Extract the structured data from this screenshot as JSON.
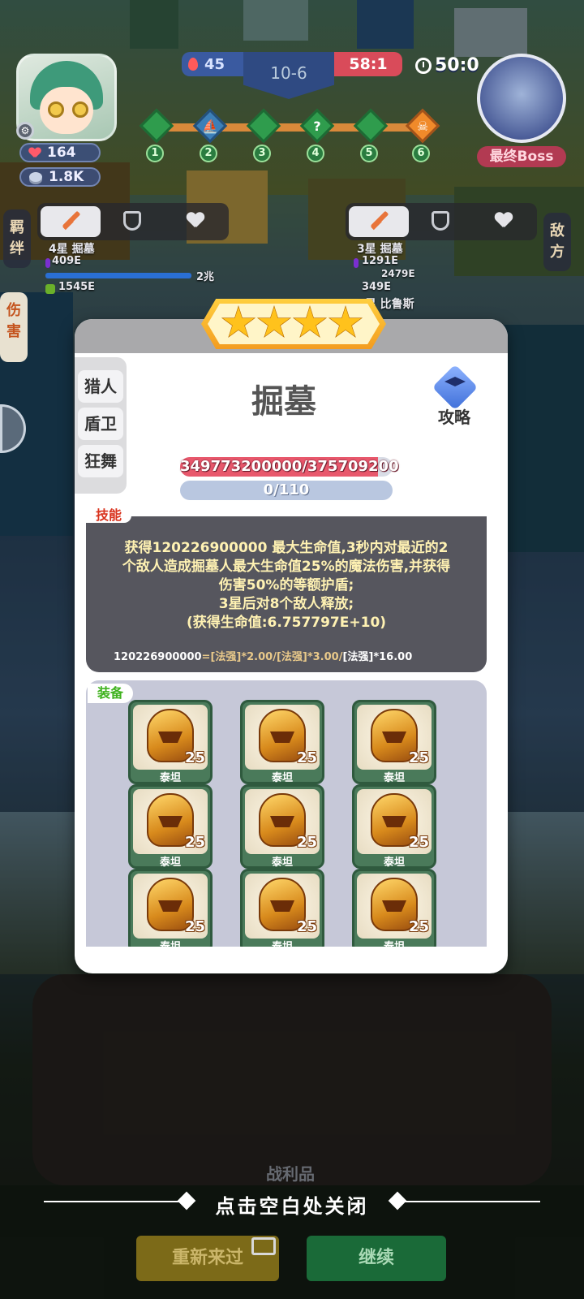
{
  "hud": {
    "player_hp": "164",
    "player_gold": "1.8K",
    "blood_count": "45",
    "stage": "10-6",
    "score_ratio": "58:1",
    "timer": "50:0",
    "boss_label": "最终Boss",
    "stage_nodes": [
      "1",
      "2",
      "3",
      "4",
      "5",
      "6"
    ],
    "node_4_glyph": "?"
  },
  "side_tags": {
    "bond": "羁绊",
    "enemy": "敌方",
    "damage": "伤害"
  },
  "left_unit": {
    "name": "4星 掘墓",
    "stat_1": "409E",
    "stat_2": "1545E",
    "bar_label": "2兆"
  },
  "right_unit": {
    "name": "3星 掘墓",
    "stat_1": "1291E",
    "stat_2": "2479E",
    "stat_3": "349E",
    "second_name": "3星 比鲁斯"
  },
  "modal": {
    "star_count": 4,
    "class_tabs": [
      "猎人",
      "盾卫",
      "狂舞"
    ],
    "hero_name": "掘墓",
    "guide_label": "攻略",
    "hp_text": "349773200000/375709200",
    "hp_fill_fraction": 0.93,
    "mana_text": "0/110",
    "skill_tag": "技能",
    "skill_lines": [
      "获得120226900000 最大生命值,3秒内对最近的2",
      "个敌人造成掘墓人最大生命值25%的魔法伤害,并获得",
      "伤害50%的等额护盾;",
      "3星后对8个敌人释放;",
      "(获得生命值:6.757797E+10)"
    ],
    "formula_value": "120226900000",
    "formula_expr": "=[法强]*2.00/[法强]*3.00/",
    "formula_tail": "[法强]*16.00",
    "equip_tag": "装备",
    "equipment": [
      {
        "name": "泰坦",
        "level": "25"
      },
      {
        "name": "泰坦",
        "level": "25"
      },
      {
        "name": "泰坦",
        "level": "25"
      },
      {
        "name": "泰坦",
        "level": "25"
      },
      {
        "name": "泰坦",
        "level": "25"
      },
      {
        "name": "泰坦",
        "level": "25"
      },
      {
        "name": "泰坦",
        "level": "25"
      },
      {
        "name": "泰坦",
        "level": "25"
      },
      {
        "name": "泰坦",
        "level": "25"
      }
    ]
  },
  "footer": {
    "spoils_label": "战利品",
    "close_hint": "点击空白处关闭",
    "retry_label": "重新来过",
    "continue_label": "继续"
  },
  "colors": {
    "hp_red": "#e8586c",
    "retry_yellow": "#b79a22",
    "continue_green": "#1f8a46"
  }
}
